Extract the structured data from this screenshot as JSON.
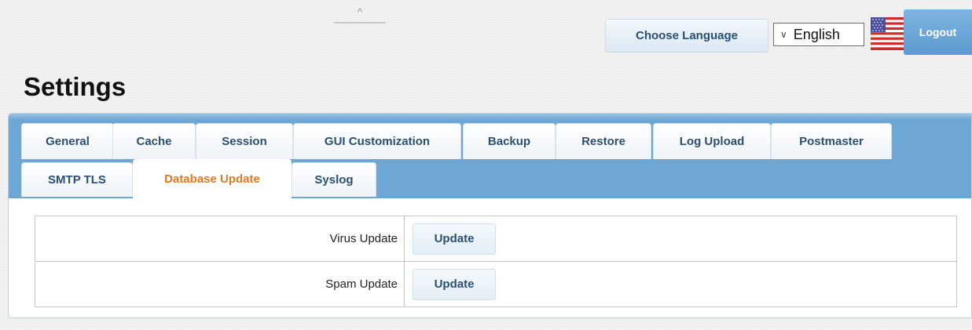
{
  "header": {
    "choose_language_label": "Choose Language",
    "language_value": "English",
    "logout_label": "Logout",
    "collapse_glyph": "^",
    "flag_icon": "us-flag-icon"
  },
  "page": {
    "title": "Settings"
  },
  "tabs": {
    "row1": [
      "General",
      "Cache",
      "Session",
      "GUI Customization",
      "Backup",
      "Restore",
      "Log Upload",
      "Postmaster"
    ],
    "row2": [
      "SMTP TLS",
      "Database Update",
      "Syslog"
    ],
    "active": "Database Update"
  },
  "updates": [
    {
      "label": "Virus Update",
      "button": "Update"
    },
    {
      "label": "Spam Update",
      "button": "Update"
    }
  ],
  "colors": {
    "accent_tab": "#e5781f",
    "tab_bar": "#6ea6d4",
    "button_text": "#2b4f72",
    "logout_bg": "#5f9ad0"
  }
}
